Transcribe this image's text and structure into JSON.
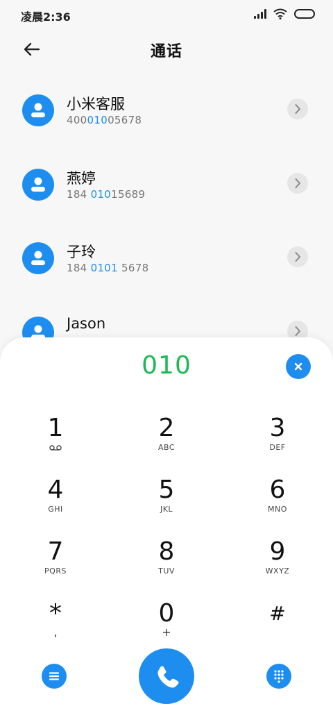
{
  "status_bar": {
    "time": "凌晨2:36",
    "icons": [
      "signal-icon",
      "wifi-icon",
      "battery-icon"
    ]
  },
  "header": {
    "title": "通话",
    "back_icon": "arrow-left-icon"
  },
  "contacts": [
    {
      "name": "小米客服",
      "number_parts": [
        "400",
        "010",
        "05678"
      ]
    },
    {
      "name": "燕婷",
      "number_parts": [
        "184 ",
        "010",
        "15689"
      ]
    },
    {
      "name": "子玲",
      "number_parts": [
        "184 ",
        "0101",
        " 5678"
      ]
    },
    {
      "name": "Jason",
      "number_parts": [
        "",
        "",
        ""
      ]
    }
  ],
  "dialer": {
    "input": "010",
    "keys": [
      {
        "digit": "1",
        "letters": "",
        "voicemail": true
      },
      {
        "digit": "2",
        "letters": "ABC"
      },
      {
        "digit": "3",
        "letters": "DEF"
      },
      {
        "digit": "4",
        "letters": "GHI"
      },
      {
        "digit": "5",
        "letters": "JKL"
      },
      {
        "digit": "6",
        "letters": "MNO"
      },
      {
        "digit": "7",
        "letters": "PQRS"
      },
      {
        "digit": "8",
        "letters": "TUV"
      },
      {
        "digit": "9",
        "letters": "WXYZ"
      },
      {
        "digit": "*",
        "sub": ","
      },
      {
        "digit": "0",
        "sub": "+"
      },
      {
        "digit": "#",
        "sub": ""
      }
    ]
  },
  "colors": {
    "accent": "#1d8ef0",
    "dial_text": "#1db954",
    "background": "#f7f7f7"
  }
}
